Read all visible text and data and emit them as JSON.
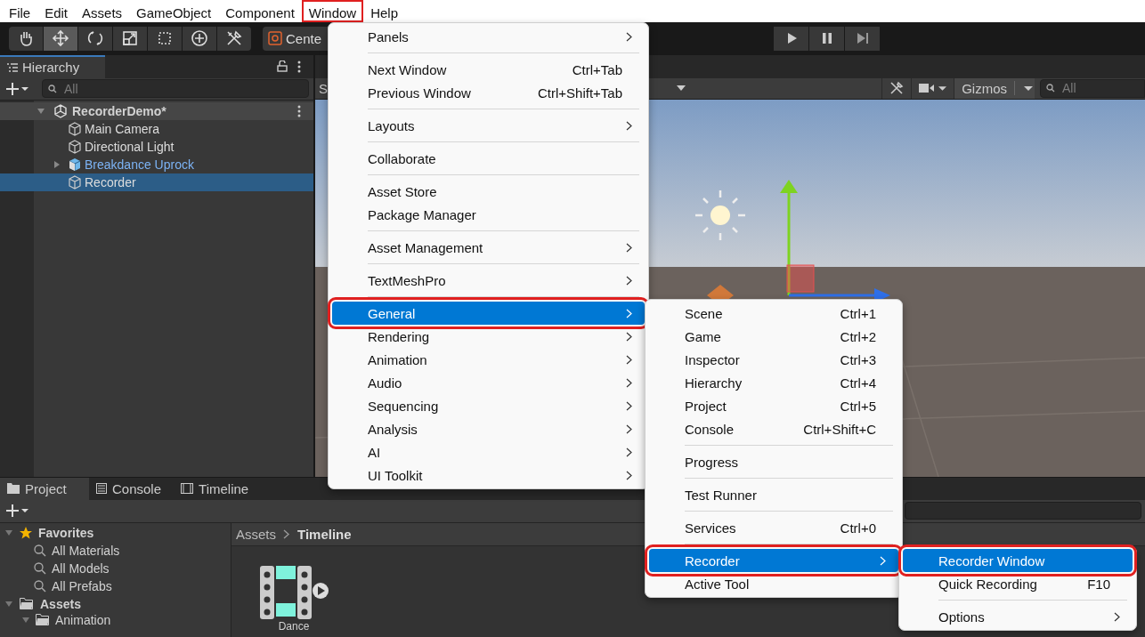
{
  "menu_bar": [
    {
      "label": "File",
      "selected": false
    },
    {
      "label": "Edit",
      "selected": false
    },
    {
      "label": "Assets",
      "selected": false
    },
    {
      "label": "GameObject",
      "selected": false
    },
    {
      "label": "Component",
      "selected": false
    },
    {
      "label": "Window",
      "selected": true
    },
    {
      "label": "Help",
      "selected": false
    }
  ],
  "toolbar": {
    "tools": [
      {
        "kind": "hand",
        "selected": false
      },
      {
        "kind": "move",
        "selected": true
      },
      {
        "kind": "rotate",
        "selected": false
      },
      {
        "kind": "scale",
        "selected": false
      },
      {
        "kind": "rect",
        "selected": false
      },
      {
        "kind": "transform",
        "selected": false
      },
      {
        "kind": "custom",
        "selected": false
      }
    ],
    "pivot_label": "Cente"
  },
  "hierarchy": {
    "title": "Hierarchy",
    "search": {
      "placeholder": "All"
    },
    "scene": {
      "label": "RecorderDemo*",
      "expanded": true,
      "children": [
        {
          "label": "Main Camera",
          "kind": "object",
          "selected": false
        },
        {
          "label": "Directional Light",
          "kind": "object",
          "selected": false
        },
        {
          "label": "Breakdance Uprock",
          "kind": "prefab",
          "expanded": false,
          "selected": false
        },
        {
          "label": "Recorder",
          "kind": "object",
          "selected": true
        }
      ]
    }
  },
  "scene_view": {
    "toolbar_label": "S",
    "gizmos_label": "Gizmos",
    "search": {
      "placeholder": "All"
    }
  },
  "project_panel": {
    "tabs": [
      {
        "label": "Project",
        "kind": "project",
        "selected": true
      },
      {
        "label": "Console",
        "kind": "console",
        "selected": false
      },
      {
        "label": "Timeline",
        "kind": "timeline",
        "selected": false
      }
    ],
    "tree": [
      {
        "label": "Favorites",
        "kind": "favorites",
        "expanded": true,
        "children": [
          {
            "label": "All Materials",
            "kind": "search"
          },
          {
            "label": "All Models",
            "kind": "search"
          },
          {
            "label": "All Prefabs",
            "kind": "search"
          }
        ]
      },
      {
        "label": "Assets",
        "kind": "folder",
        "expanded": true,
        "children": [
          {
            "label": "Animation",
            "kind": "folder",
            "expanded": true
          }
        ]
      }
    ],
    "breadcrumb": [
      "Assets",
      "Timeline"
    ],
    "assets": [
      {
        "label": "Dance",
        "kind": "timeline"
      }
    ]
  },
  "window_menu": {
    "groups": [
      {
        "items": [
          {
            "label": "Panels",
            "submenu": true,
            "selected": false
          }
        ]
      },
      {
        "items": [
          {
            "label": "Next Window",
            "shortcut": "Ctrl+Tab",
            "selected": false
          },
          {
            "label": "Previous Window",
            "shortcut": "Ctrl+Shift+Tab",
            "selected": false
          }
        ]
      },
      {
        "items": [
          {
            "label": "Layouts",
            "submenu": true,
            "selected": false
          }
        ]
      },
      {
        "items": [
          {
            "label": "Collaborate",
            "selected": false
          }
        ]
      },
      {
        "items": [
          {
            "label": "Asset Store",
            "selected": false
          },
          {
            "label": "Package Manager",
            "selected": false
          }
        ]
      },
      {
        "items": [
          {
            "label": "Asset Management",
            "submenu": true,
            "selected": false
          }
        ]
      },
      {
        "items": [
          {
            "label": "TextMeshPro",
            "submenu": true,
            "selected": false
          }
        ]
      },
      {
        "items": [
          {
            "label": "General",
            "submenu": true,
            "selected": true
          },
          {
            "label": "Rendering",
            "submenu": true,
            "selected": false
          },
          {
            "label": "Animation",
            "submenu": true,
            "selected": false
          },
          {
            "label": "Audio",
            "submenu": true,
            "selected": false
          },
          {
            "label": "Sequencing",
            "submenu": true,
            "selected": false
          },
          {
            "label": "Analysis",
            "submenu": true,
            "selected": false
          },
          {
            "label": "AI",
            "submenu": true,
            "selected": false
          },
          {
            "label": "UI Toolkit",
            "submenu": true,
            "selected": false
          }
        ]
      }
    ]
  },
  "general_menu": {
    "groups": [
      {
        "items": [
          {
            "label": "Scene",
            "shortcut": "Ctrl+1",
            "selected": false
          },
          {
            "label": "Game",
            "shortcut": "Ctrl+2",
            "selected": false
          },
          {
            "label": "Inspector",
            "shortcut": "Ctrl+3",
            "selected": false
          },
          {
            "label": "Hierarchy",
            "shortcut": "Ctrl+4",
            "selected": false
          },
          {
            "label": "Project",
            "shortcut": "Ctrl+5",
            "selected": false
          },
          {
            "label": "Console",
            "shortcut": "Ctrl+Shift+C",
            "selected": false
          }
        ]
      },
      {
        "items": [
          {
            "label": "Progress",
            "selected": false
          }
        ]
      },
      {
        "items": [
          {
            "label": "Test Runner",
            "selected": false
          }
        ]
      },
      {
        "items": [
          {
            "label": "Services",
            "shortcut": "Ctrl+0",
            "selected": false
          }
        ]
      },
      {
        "items": [
          {
            "label": "Recorder",
            "submenu": true,
            "selected": true
          },
          {
            "label": "Active Tool",
            "selected": false
          }
        ]
      }
    ]
  },
  "recorder_menu": {
    "groups": [
      {
        "items": [
          {
            "label": "Recorder Window",
            "selected": true
          },
          {
            "label": "Quick Recording",
            "shortcut": "F10",
            "selected": false
          }
        ]
      },
      {
        "items": [
          {
            "label": "Options",
            "submenu": true,
            "selected": false
          }
        ]
      }
    ]
  }
}
